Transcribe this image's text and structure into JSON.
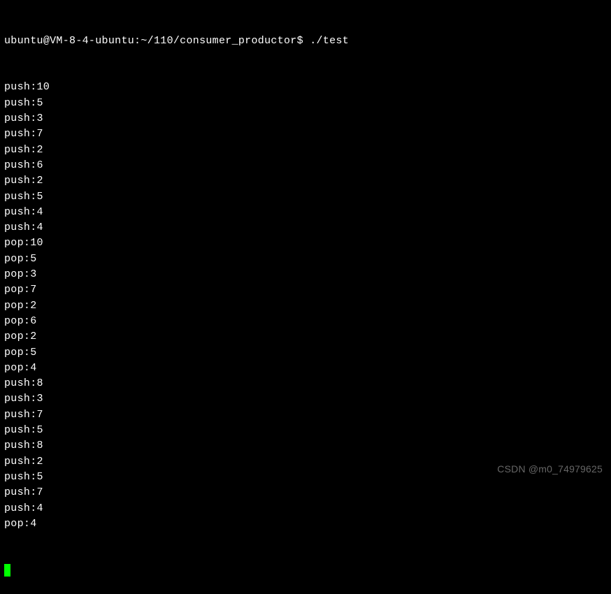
{
  "prompt": {
    "user": "ubuntu",
    "host": "VM-8-4-ubuntu",
    "path": "~/110/consumer_productor",
    "symbol": "$",
    "command": "./test"
  },
  "output_lines": [
    "push:10",
    "push:5",
    "push:3",
    "push:7",
    "push:2",
    "push:6",
    "push:2",
    "push:5",
    "push:4",
    "push:4",
    "pop:10",
    "pop:5",
    "pop:3",
    "pop:7",
    "pop:2",
    "pop:6",
    "pop:2",
    "pop:5",
    "pop:4",
    "push:8",
    "push:3",
    "push:7",
    "push:5",
    "push:8",
    "push:2",
    "push:5",
    "push:7",
    "push:4",
    "pop:4"
  ],
  "watermark": "CSDN @m0_74979625"
}
